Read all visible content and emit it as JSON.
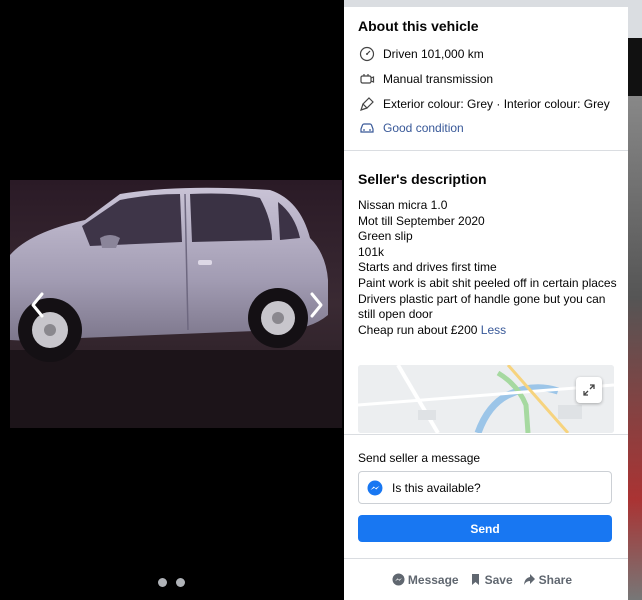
{
  "about": {
    "title": "About this vehicle",
    "items": [
      {
        "icon": "speedometer-icon",
        "text": "Driven 101,000 km"
      },
      {
        "icon": "transmission-icon",
        "text": "Manual transmission"
      },
      {
        "icon": "paint-brush-icon",
        "text": "Exterior colour: Grey · Interior colour: Grey"
      },
      {
        "icon": "car-icon",
        "text": "Good condition"
      }
    ]
  },
  "description": {
    "title": "Seller's description",
    "lines": [
      "Nissan micra 1.0",
      "Mot till September 2020",
      "Green slip",
      "101k",
      "Starts and drives first time",
      "Paint work is abit shit peeled off in certain places",
      "Drivers plastic part of handle gone but you can still open door",
      "Cheap run about £200"
    ],
    "less_label": "Less"
  },
  "message": {
    "title": "Send seller a message",
    "input_value": "Is this available?",
    "send_label": "Send"
  },
  "actions": {
    "message_label": "Message",
    "save_label": "Save",
    "share_label": "Share"
  },
  "colors": {
    "accent": "#1877f2",
    "link": "#385898",
    "car_body": "#a9a3b8"
  },
  "photos": {
    "count": 2
  }
}
